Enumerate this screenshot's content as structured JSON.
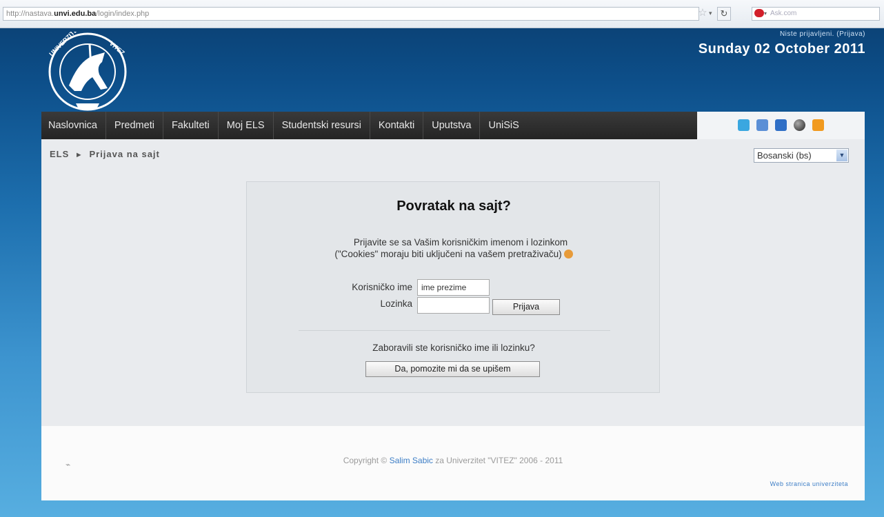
{
  "browser": {
    "url_prefix": "http://nastava.",
    "url_domain": "unvi.edu.ba",
    "url_path": "/login/index.php",
    "search_placeholder": "Ask.com"
  },
  "header": {
    "login_status_prefix": "Niste prijavljeni. (",
    "login_link": "Prijava",
    "login_status_suffix": ")",
    "date": "Sunday 02 October 2011"
  },
  "nav": {
    "items": [
      {
        "label": "Naslovnica"
      },
      {
        "label": "Predmeti"
      },
      {
        "label": "Fakulteti"
      },
      {
        "label": "Moj ELS"
      },
      {
        "label": "Studentski resursi"
      },
      {
        "label": "Kontakti"
      },
      {
        "label": "Uputstva"
      },
      {
        "label": "UniSiS"
      }
    ],
    "icons": [
      {
        "name": "chat-icon",
        "color": "#3aa7e0"
      },
      {
        "name": "calendar-icon",
        "color": "#5b8fd6"
      },
      {
        "name": "mail-icon",
        "color": "#2f6fc6"
      },
      {
        "name": "globe-icon",
        "color": "#444444"
      },
      {
        "name": "rss-icon",
        "color": "#f19a1f"
      }
    ]
  },
  "breadcrumb": {
    "root": "ELS",
    "separator": "►",
    "current": "Prijava na sajt"
  },
  "language": {
    "selected": "Bosanski (bs)"
  },
  "login": {
    "title": "Povratak na sajt?",
    "intro_line1": "Prijavite se sa Vašim korisničkim imenom i lozinkom",
    "intro_line2": "(\"Cookies\" moraju biti uključeni na vašem pretraživaču)",
    "username_label": "Korisničko ime",
    "username_value": "ime prezime",
    "password_label": "Lozinka",
    "password_value": "",
    "login_button": "Prijava",
    "forgot_text": "Zaboravili ste korisničko ime ili lozinku?",
    "help_button": "Da, pomozite mi da se upišem"
  },
  "footer": {
    "copyright_prefix": "Copyright © ",
    "author": "Salim Sabic",
    "copyright_suffix": " za Univerzitet \"VITEZ\" 2006 - 2011",
    "web_link": "Web stranica univerziteta"
  }
}
